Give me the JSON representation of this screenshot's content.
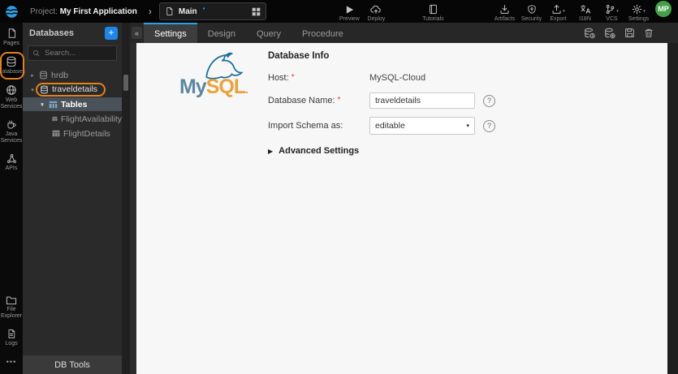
{
  "topbar": {
    "project_label": "Project:",
    "project_name": "My First Application",
    "breadcrumb_chevron": "›",
    "page_name": "Main",
    "unsaved_dot": "•",
    "actions": {
      "preview": "Preview",
      "deploy": "Deploy",
      "tutorials": "Tutorials",
      "artifacts": "Artifacts",
      "security": "Security",
      "export": "Export",
      "i18n": "I18N",
      "vcs": "VCS",
      "settings": "Settings"
    },
    "avatar_initials": "MP"
  },
  "sidebar": {
    "items": [
      {
        "label": "Pages"
      },
      {
        "label": "Databases",
        "active": true
      },
      {
        "label": "Web Services"
      },
      {
        "label": "Java Services"
      },
      {
        "label": "APIs"
      }
    ],
    "bottom_items": [
      {
        "label": "File Explorer"
      },
      {
        "label": "Logs"
      }
    ],
    "more": "•••"
  },
  "db_panel": {
    "title": "Databases",
    "add_glyph": "+",
    "search_placeholder": "Search...",
    "tree": [
      {
        "label": "hrdb",
        "state": "collapsed"
      },
      {
        "label": "traveldetails",
        "state": "expanded",
        "annotated": true
      },
      {
        "label": "Tables",
        "state": "expanded",
        "selected": true
      },
      {
        "label": "FlightAvailability"
      },
      {
        "label": "FlightDetails"
      }
    ],
    "footer": "DB Tools"
  },
  "main": {
    "collapse_glyph": "«",
    "tabs": [
      {
        "label": "Settings",
        "active": true
      },
      {
        "label": "Design"
      },
      {
        "label": "Query"
      },
      {
        "label": "Procedure"
      }
    ],
    "toolbar_icons": [
      "reimport-database",
      "export-database",
      "save",
      "delete"
    ],
    "logo": {
      "part1": "My",
      "part2": "SQL",
      "dot": "."
    },
    "form": {
      "section_title": "Database Info",
      "host_label": "Host:",
      "host_value": "MySQL-Cloud",
      "db_name_label": "Database Name:",
      "db_name_value": "traveldetails",
      "import_label": "Import Schema as:",
      "import_value": "editable",
      "advanced_label": "Advanced Settings",
      "required_marker": "*",
      "help_glyph": "?",
      "advanced_caret": "▶",
      "select_caret": "▾"
    }
  },
  "glyphs": {
    "caret_collapsed": "▸",
    "caret_expanded": "▾"
  },
  "colors": {
    "accent_blue": "#1d86e8",
    "tab_accent_blue": "#2e9fe6",
    "annotation_orange": "#e2821f",
    "avatar_green": "#43a047",
    "mysql_blue": "#5d87a1",
    "mysql_orange": "#e8a33d",
    "required_red": "#e53935",
    "selected_row_gray": "#4a5158"
  }
}
